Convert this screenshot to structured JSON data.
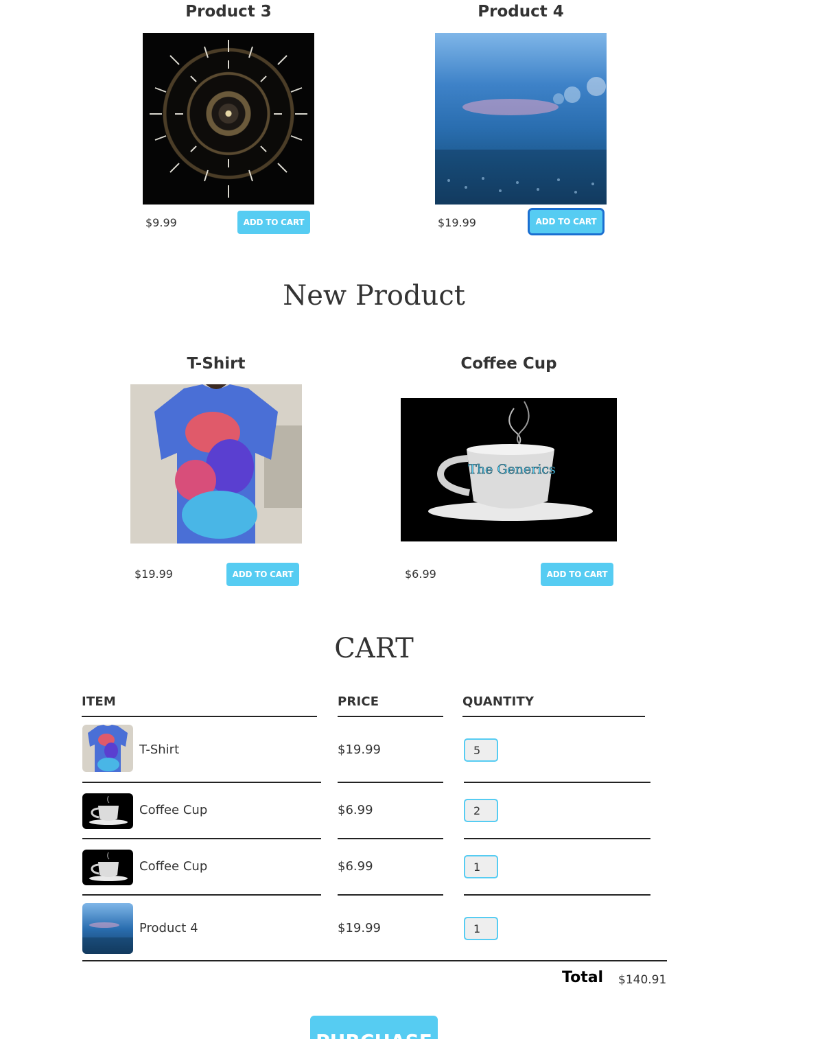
{
  "products_top": [
    {
      "title": "Product 3",
      "price": "$9.99",
      "button": "ADD TO CART"
    },
    {
      "title": "Product 4",
      "price": "$19.99",
      "button": "ADD TO CART"
    }
  ],
  "new_product_section": {
    "heading": "New Product",
    "products": [
      {
        "title": "T-Shirt",
        "price": "$19.99",
        "button": "ADD TO CART"
      },
      {
        "title": "Coffee Cup",
        "price": "$6.99",
        "button": "ADD TO CART",
        "logo_text": "The Generics"
      }
    ]
  },
  "cart": {
    "heading": "CART",
    "columns": [
      "ITEM",
      "PRICE",
      "QUANTITY"
    ],
    "rows": [
      {
        "item": "T-Shirt",
        "price": "$19.99",
        "quantity": "5"
      },
      {
        "item": "Coffee Cup",
        "price": "$6.99",
        "quantity": "2"
      },
      {
        "item": "Coffee Cup",
        "price": "$6.99",
        "quantity": "1"
      },
      {
        "item": "Product 4",
        "price": "$19.99",
        "quantity": "1"
      }
    ],
    "total_label": "Total",
    "total_value": "$140.91",
    "purchase_button": "PURCHASE"
  },
  "colors": {
    "accent": "#56ccf2",
    "focus_ring": "#1a6fd1",
    "text": "#333333"
  }
}
